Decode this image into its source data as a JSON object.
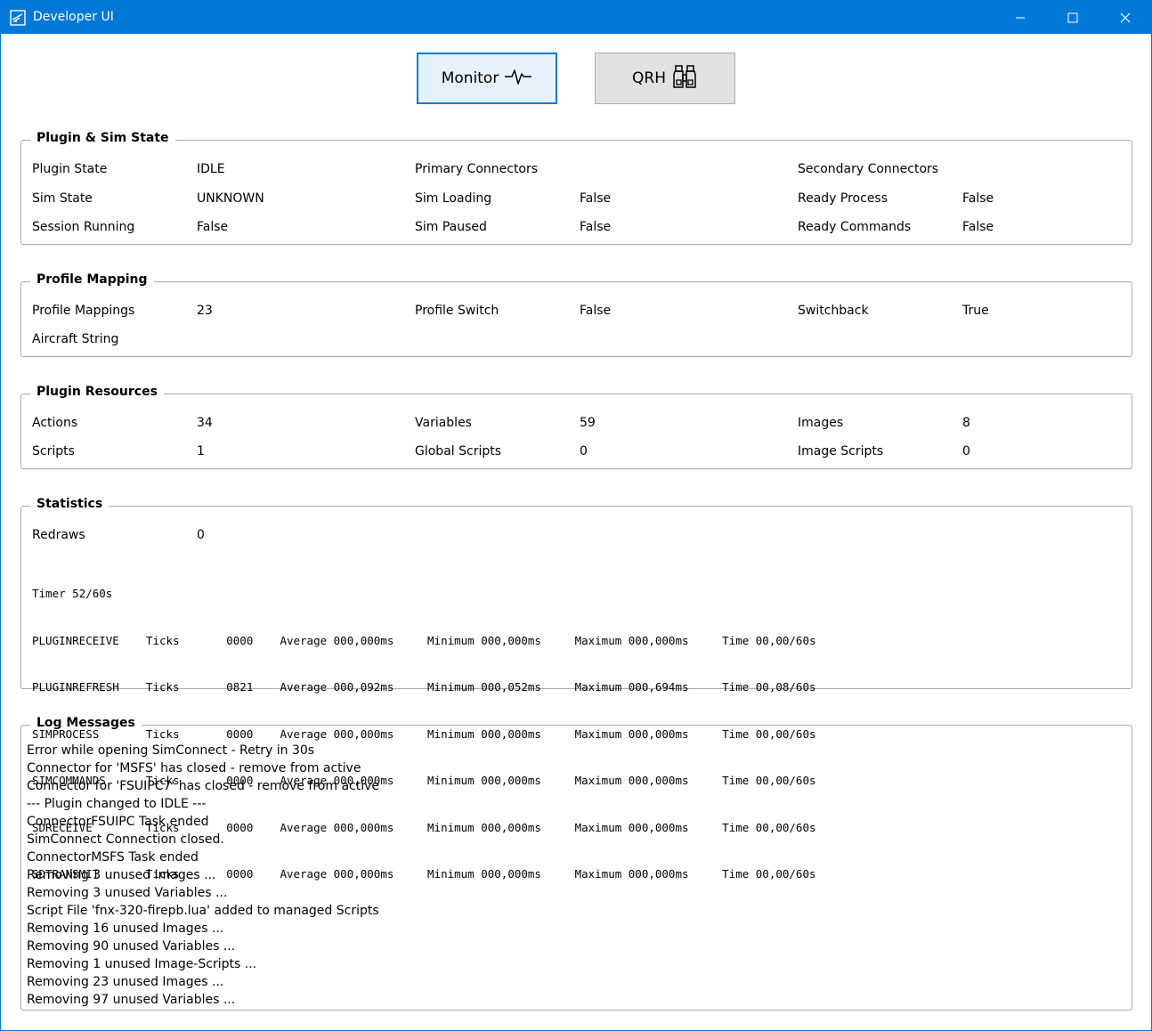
{
  "window": {
    "title": "Developer UI"
  },
  "toolbar": {
    "monitor_label": "Monitor",
    "qrh_label": "QRH",
    "monitor_icon": "pulse-icon",
    "qrh_icon": "binoculars-icon"
  },
  "plugin_sim_state": {
    "title": "Plugin & Sim State",
    "plugin_state_label": "Plugin State",
    "plugin_state_value": "IDLE",
    "primary_connectors_label": "Primary Connectors",
    "secondary_connectors_label": "Secondary Connectors",
    "sim_state_label": "Sim State",
    "sim_state_value": "UNKNOWN",
    "sim_loading_label": "Sim Loading",
    "sim_loading_value": "False",
    "ready_process_label": "Ready Process",
    "ready_process_value": "False",
    "session_running_label": "Session Running",
    "session_running_value": "False",
    "sim_paused_label": "Sim Paused",
    "sim_paused_value": "False",
    "ready_commands_label": "Ready Commands",
    "ready_commands_value": "False"
  },
  "profile_mapping": {
    "title": "Profile Mapping",
    "profile_mappings_label": "Profile Mappings",
    "profile_mappings_value": "23",
    "profile_switch_label": "Profile Switch",
    "profile_switch_value": "False",
    "switchback_label": "Switchback",
    "switchback_value": "True",
    "aircraft_string_label": "Aircraft String"
  },
  "plugin_resources": {
    "title": "Plugin Resources",
    "actions_label": "Actions",
    "actions_value": "34",
    "variables_label": "Variables",
    "variables_value": "59",
    "images_label": "Images",
    "images_value": "8",
    "scripts_label": "Scripts",
    "scripts_value": "1",
    "global_scripts_label": "Global Scripts",
    "global_scripts_value": "0",
    "image_scripts_label": "Image Scripts",
    "image_scripts_value": "0"
  },
  "statistics": {
    "title": "Statistics",
    "redraws_label": "Redraws",
    "redraws_value": "0",
    "lines": [
      "Timer 52/60s",
      "PLUGINRECEIVE    Ticks       0000    Average 000,000ms     Minimum 000,000ms     Maximum 000,000ms     Time 00,00/60s",
      "PLUGINREFRESH    Ticks       0821    Average 000,092ms     Minimum 000,052ms     Maximum 000,694ms     Time 00,08/60s",
      "SIMPROCESS       Ticks       0000    Average 000,000ms     Minimum 000,000ms     Maximum 000,000ms     Time 00,00/60s",
      "SIMCOMMANDS      Ticks       0000    Average 000,000ms     Minimum 000,000ms     Maximum 000,000ms     Time 00,00/60s",
      "SDRECEIVE        Ticks       0000    Average 000,000ms     Minimum 000,000ms     Maximum 000,000ms     Time 00,00/60s",
      "SDTRANSMIT       Ticks       0000    Average 000,000ms     Minimum 000,000ms     Maximum 000,000ms     Time 00,00/60s"
    ]
  },
  "log_messages": {
    "title": "Log Messages",
    "items": [
      "Error while opening SimConnect - Retry in 30s",
      "Connector for 'MSFS' has closed - remove from active",
      "Connector for 'FSUIPC7' has closed - remove from active",
      "--- Plugin changed to IDLE ---",
      "ConnectorFSUIPC Task ended",
      "SimConnect Connection closed.",
      "ConnectorMSFS Task ended",
      "Removing 3 unused Images ...",
      "Removing 3 unused Variables ...",
      "Script File 'fnx-320-firepb.lua' added to managed Scripts",
      "Removing 16 unused Images ...",
      "Removing 90 unused Variables ...",
      "Removing 1 unused Image-Scripts ...",
      "Removing 23 unused Images ...",
      "Removing 97 unused Variables ..."
    ]
  }
}
